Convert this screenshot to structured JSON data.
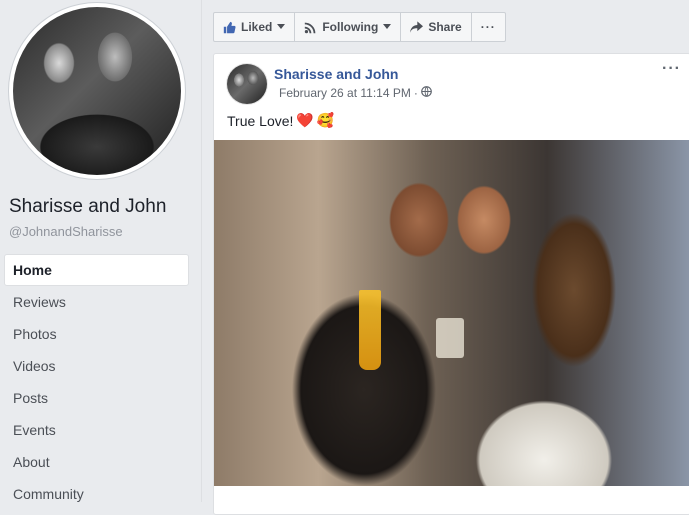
{
  "page": {
    "name": "Sharisse and John",
    "handle": "@JohnandSharisse"
  },
  "nav": {
    "items": [
      {
        "label": "Home"
      },
      {
        "label": "Reviews"
      },
      {
        "label": "Photos"
      },
      {
        "label": "Videos"
      },
      {
        "label": "Posts"
      },
      {
        "label": "Events"
      },
      {
        "label": "About"
      },
      {
        "label": "Community"
      }
    ]
  },
  "actions": {
    "liked": "Liked",
    "following": "Following",
    "share": "Share",
    "more": "···"
  },
  "post": {
    "author": "Sharisse and John",
    "time": "February 26 at 11:14 PM",
    "separator": "·",
    "text": "True Love!",
    "more": "···",
    "emoji": [
      "❤️",
      "🥰"
    ]
  },
  "colors": {
    "link": "#365899",
    "background": "#e9ebee",
    "heart": "#e0245e"
  },
  "icons": [
    "thumbs-up-icon",
    "rss-icon",
    "share-arrow-icon",
    "globe-icon",
    "chevron-down-icon"
  ]
}
